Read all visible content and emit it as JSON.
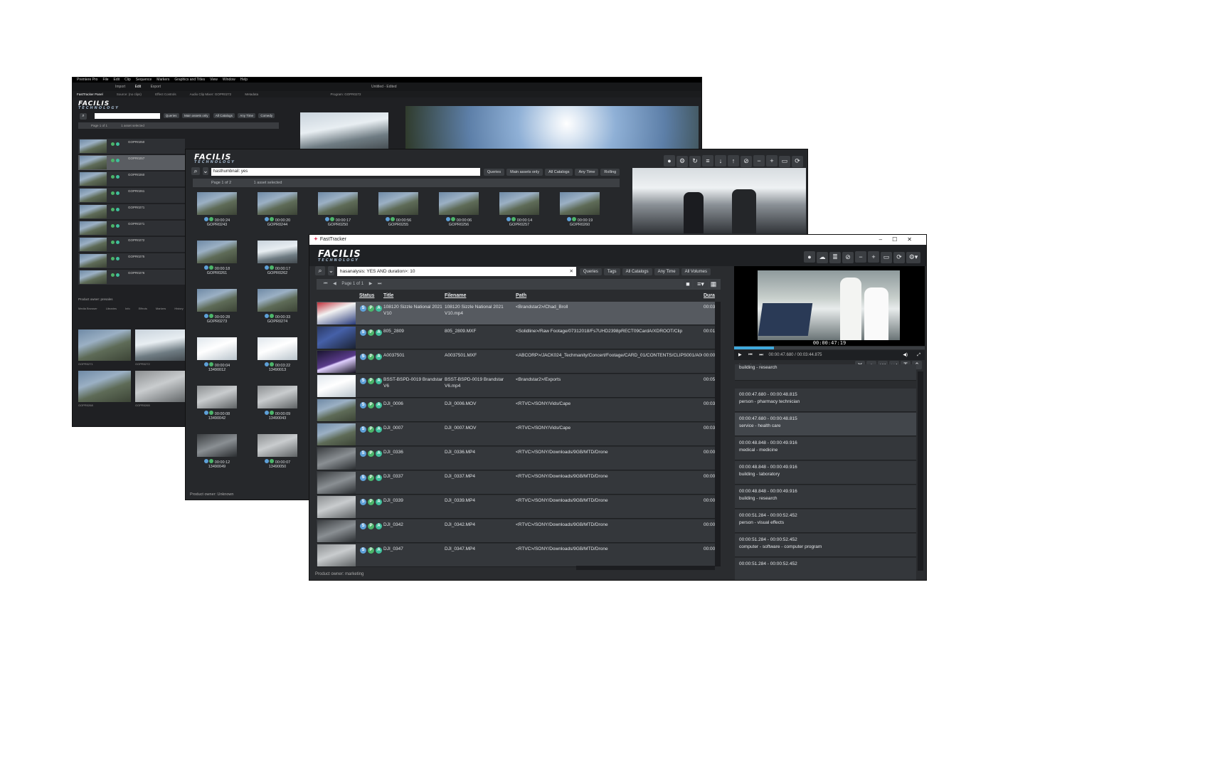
{
  "back_window": {
    "app_menu": [
      "Premiere Pro",
      "File",
      "Edit",
      "Clip",
      "Sequence",
      "Markers",
      "Graphics and Titles",
      "View",
      "Window",
      "Help"
    ],
    "workspace_tabs": [
      "Import",
      "Edit",
      "Export"
    ],
    "project_title": "Untitled - Edited",
    "panel_tabs": [
      "FastTracker Panel",
      "Source: (no clips)",
      "Effect Controls",
      "Audio Clip Mixer: GOPR0272",
      "Metadata"
    ],
    "program_tab": "Program: GOPR0272",
    "filters": [
      "Queries",
      "Main assets only",
      "All Catalogs",
      "Any Time",
      "Comedy"
    ],
    "pager": "Page 1 of 1",
    "selection": "1 asset selected",
    "rows": [
      "GOPR0250",
      "GOPR0257",
      "GOPR0260",
      "GOPR0261",
      "GOPR0271",
      "GOPR0271",
      "GOPR0272",
      "GOPR0275",
      "GOPR0276"
    ],
    "preview_caption": "GOPR0250.MP4",
    "owner": "Product owner: presales",
    "bottom_tabs": [
      "Media Browser",
      "Libraries",
      "Info",
      "Effects",
      "Markers",
      "History"
    ],
    "bin_labels": [
      "GOPR0271",
      "GOPR0272",
      "GOPR0268",
      "GOPR0265"
    ]
  },
  "middle_window": {
    "search_value": "hasthumbnail: yes",
    "filters": [
      "Queries",
      "Main assets only",
      "All Catalogs",
      "Any Time",
      "Rolling"
    ],
    "pager": "Page 1 of 2",
    "selection": "1 asset selected",
    "tiles": [
      {
        "time": "00:00:24",
        "name": "GOPR0243"
      },
      {
        "time": "00:00:20",
        "name": "GOPR0244"
      },
      {
        "time": "00:00:17",
        "name": "GOPR0250"
      },
      {
        "time": "00:00:56",
        "name": "GOPR0255"
      },
      {
        "time": "00:00:06",
        "name": "GOPR0256"
      },
      {
        "time": "00:00:14",
        "name": "GOPR0257"
      },
      {
        "time": "00:00:19",
        "name": "GOPR0260"
      },
      {
        "time": "00:00:18",
        "name": "GOPR0261"
      },
      {
        "time": "00:00:17",
        "name": "GOPR0262"
      },
      {
        "time": "00:00:28",
        "name": "GOPR0273"
      },
      {
        "time": "00:00:33",
        "name": "GOPR0274"
      },
      {
        "time": "00:00:04",
        "name": "13490012"
      },
      {
        "time": "00:03:22",
        "name": "13490013"
      },
      {
        "time": "00:00:08",
        "name": "13490042"
      },
      {
        "time": "00:00:09",
        "name": "13490043"
      },
      {
        "time": "00:00:12",
        "name": "13490049"
      },
      {
        "time": "00:00:07",
        "name": "13490050"
      }
    ],
    "owner": "Product owner: Unknown"
  },
  "front_window": {
    "title": "FastTracker",
    "logo": "FACILIS",
    "logo_sub": "TECHNOLOGY",
    "search_value": "hasanalysis: YES AND duration>: 10",
    "filters": [
      "Queries",
      "Tags",
      "All Catalogs",
      "Any Time",
      "All Volumes"
    ],
    "pager": "Page 1 of 1",
    "columns": {
      "status": "Status",
      "title": "Title",
      "filename": "Filename",
      "path": "Path",
      "duration": "Dura"
    },
    "rows": [
      {
        "title": "108120 Sizzle National 2021 V10",
        "filename": "108120 Sizzle National 2021 V10.mp4",
        "path": "<Brandstar2>/Chad_Broll",
        "dur": "00:03",
        "thumb": "e"
      },
      {
        "title": "805_2809",
        "filename": "805_2809.MXF",
        "path": "<Solidline>/Raw Footage/07312018/Fs7UHD2398pRECT09CardA/XDROOT/Clip",
        "dur": "00:01",
        "thumb": "c"
      },
      {
        "title": "A0037501",
        "filename": "A0037501.MXF",
        "path": "<ABCORP>/JACK024_Techmanity/Concert/Footage/CARD_01/CONTENTS/CLIPS001/A00375",
        "dur": "00:00",
        "thumb": "f"
      },
      {
        "title": "BSST-BSPD-0019 Brandstar V6",
        "filename": "BSST-BSPD-0019 Brandstar V6.mp4",
        "path": "<Brandstar2>/Exports",
        "dur": "00:05",
        "thumb": "g"
      },
      {
        "title": "DJI_0006",
        "filename": "DJI_0006.MOV",
        "path": "<RTVC>/SONY/Vids/Cape",
        "dur": "00:03",
        "thumb": "a"
      },
      {
        "title": "DJI_0007",
        "filename": "DJI_0007.MOV",
        "path": "<RTVC>/SONY/Vids/Cape",
        "dur": "00:03",
        "thumb": "a"
      },
      {
        "title": "DJI_0336",
        "filename": "DJI_0336.MP4",
        "path": "<RTVC>/SONY/Downloads/9GB/MTD/Drone",
        "dur": "00:00",
        "thumb": "h"
      },
      {
        "title": "DJI_0337",
        "filename": "DJI_0337.MP4",
        "path": "<RTVC>/SONY/Downloads/9GB/MTD/Drone",
        "dur": "00:00",
        "thumb": "h"
      },
      {
        "title": "DJI_0339",
        "filename": "DJI_0339.MP4",
        "path": "<RTVC>/SONY/Downloads/9GB/MTD/Drone",
        "dur": "00:00",
        "thumb": "d"
      },
      {
        "title": "DJI_0342",
        "filename": "DJI_0342.MP4",
        "path": "<RTVC>/SONY/Downloads/9GB/MTD/Drone",
        "dur": "00:00",
        "thumb": "h"
      },
      {
        "title": "DJI_0347",
        "filename": "DJI_0347.MP4",
        "path": "<RTVC>/SONY/Downloads/9GB/MTD/Drone",
        "dur": "00:00",
        "thumb": "d"
      }
    ],
    "player": {
      "timecode": "00:00:47:19",
      "position": "00:00:47.680 / 00:03:44.875",
      "progress": 0.21
    },
    "tags": [
      {
        "time": "00:00:47.680 - 00:00:48.815",
        "label": "building - research"
      },
      {
        "time": "00:00:47.680 - 00:00:48.815",
        "label": "person - pharmacy technician"
      },
      {
        "time": "00:00:47.680 - 00:00:48.815",
        "label": "service - health care"
      },
      {
        "time": "00:00:48.848 - 00:00:49.916",
        "label": "medical - medicine"
      },
      {
        "time": "00:00:48.848 - 00:00:49.916",
        "label": "building - laboratory"
      },
      {
        "time": "00:00:48.848 - 00:00:49.916",
        "label": "building - research"
      },
      {
        "time": "00:00:51.284 - 00:00:52.452",
        "label": "person - visual effects"
      },
      {
        "time": "00:00:51.284 - 00:00:52.452",
        "label": "computer - software - computer program"
      },
      {
        "time": "00:00:51.284 - 00:00:52.452",
        "label": ""
      }
    ],
    "owner": "Product owner: marketing"
  }
}
